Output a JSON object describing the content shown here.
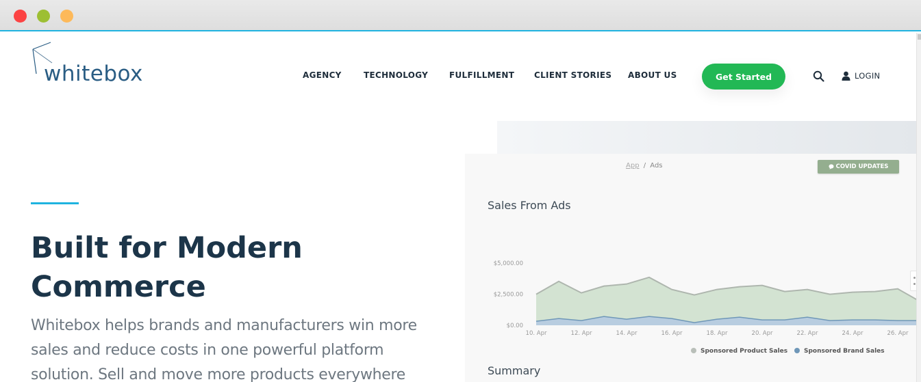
{
  "window": {
    "controls": [
      "close",
      "minimize",
      "maximize"
    ]
  },
  "brand": {
    "name": "whitebox",
    "color": "#2a5d84"
  },
  "nav": {
    "items": [
      {
        "label": "AGENCY"
      },
      {
        "label": "TECHNOLOGY"
      },
      {
        "label": "FULFILLMENT"
      },
      {
        "label": "CLIENT STORIES"
      },
      {
        "label": "ABOUT US"
      }
    ],
    "cta_label": "Get Started",
    "cta_color": "#22b855",
    "search_icon": "search-icon",
    "login_icon": "user-icon",
    "login_label": "LOGIN"
  },
  "hero": {
    "title": "Built for Modern Commerce",
    "text": "Whitebox helps brands and manufacturers win more sales and reduce costs in one powerful platform solution. Sell and move more products everywhere",
    "accent_color": "#1fb3e0"
  },
  "app_preview": {
    "breadcrumb": {
      "root": "App",
      "separator": "/",
      "current": "Ads"
    },
    "covid_button": {
      "icon": "chat-bubble-icon",
      "label": "COVID UPDATES"
    },
    "chart_title": "Sales From Ads",
    "summary_title": "Summary"
  },
  "chart_data": {
    "type": "area",
    "stacked": true,
    "title": "Sales From Ads",
    "xlabel": "",
    "ylabel": "",
    "x": [
      "10. Apr",
      "11. Apr",
      "12. Apr",
      "13. Apr",
      "14. Apr",
      "15. Apr",
      "16. Apr",
      "17. Apr",
      "18. Apr",
      "19. Apr",
      "20. Apr",
      "21. Apr",
      "22. Apr",
      "23. Apr",
      "24. Apr",
      "25. Apr",
      "26. Apr",
      "27. Apr"
    ],
    "x_tick_labels": [
      "10. Apr",
      "12. Apr",
      "14. Apr",
      "16. Apr",
      "18. Apr",
      "20. Apr",
      "22. Apr",
      "24. Apr",
      "26. Apr"
    ],
    "y_tick_labels": [
      "$0.00",
      "$2,500.00",
      "$5,000.00"
    ],
    "ylim": [
      0,
      5000
    ],
    "grid": false,
    "legend_position": "bottom-right",
    "series": [
      {
        "name": "Sponsored Product Sales",
        "color": "#b9bfb9",
        "fill": "#d3e3d2",
        "line": "#aeb6ae",
        "values": [
          2170,
          2985,
          2225,
          2445,
          2825,
          3150,
          2335,
          2225,
          2390,
          2445,
          2770,
          2280,
          2225,
          2115,
          2225,
          2280,
          2550,
          1520
        ]
      },
      {
        "name": "Sponsored Brand Sales",
        "color": "#6f97b8",
        "fill": "#b8cde0",
        "line": "#6f97b8",
        "values": [
          325,
          545,
          380,
          705,
          490,
          705,
          545,
          215,
          490,
          650,
          435,
          435,
          650,
          380,
          435,
          435,
          380,
          380
        ]
      }
    ]
  }
}
